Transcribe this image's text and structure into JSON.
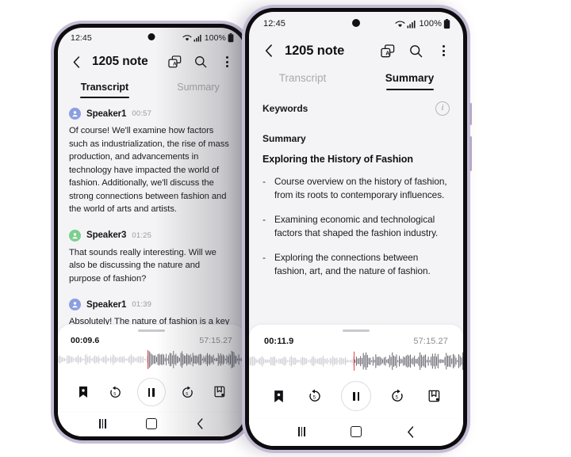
{
  "background_color": "#ffffff",
  "frame_color": "#c4bcd4",
  "bezel_color": "#0d0d10",
  "screen_bg": "#f4f4f6",
  "accent_playhead": "#e8413f",
  "phones": [
    {
      "id": "left",
      "status_bar": {
        "time": "12:45",
        "battery_percent": "100%"
      },
      "app_bar": {
        "title": "1205 note"
      },
      "tabs": [
        {
          "label": "Transcript",
          "active": true
        },
        {
          "label": "Summary",
          "active": false
        }
      ],
      "transcript": [
        {
          "speaker": "Speaker1",
          "time": "00:57",
          "avatar_color": "#8b9ee0",
          "text": "Of course! We'll examine how factors such as industrialization, the rise of mass production, and advancements in technology have impacted the world of fashion. Additionally, we'll discuss the strong connections between fashion and the world of arts and artists."
        },
        {
          "speaker": "Speaker3",
          "time": "01:25",
          "avatar_color": "#7ccf8e",
          "text": "That sounds really interesting. Will we also be discussing the nature and purpose of fashion?"
        },
        {
          "speaker": "Speaker1",
          "time": "01:39",
          "avatar_color": "#8b9ee0",
          "text": "Absolutely! The nature of fashion is a key topic we'll be exploring."
        }
      ],
      "player": {
        "current_time": "00:09.6",
        "total_time": "57:15.27",
        "playhead_percent": 48,
        "controls": [
          {
            "name": "bookmark-button",
            "label": "Bookmark"
          },
          {
            "name": "rewind-5-button",
            "label": "5"
          },
          {
            "name": "pause-button",
            "label": "Pause"
          },
          {
            "name": "forward-5-button",
            "label": "5"
          },
          {
            "name": "clip-note-button",
            "label": "Clip"
          }
        ]
      },
      "nav_bar": {
        "recents": "Recents",
        "home": "Home",
        "back": "Back"
      }
    },
    {
      "id": "right",
      "status_bar": {
        "time": "12:45",
        "battery_percent": "100%"
      },
      "app_bar": {
        "title": "1205 note"
      },
      "tabs": [
        {
          "label": "Transcript",
          "active": false
        },
        {
          "label": "Summary",
          "active": true
        }
      ],
      "summary": {
        "keywords_label": "Keywords",
        "summary_label": "Summary",
        "heading": "Exploring the History of Fashion",
        "bullets": [
          "Course overview on the history of fashion, from its roots to contemporary influences.",
          "Examining economic and technological factors that shaped the fashion industry.",
          "Exploring the connections between fashion, art, and the nature of fashion."
        ]
      },
      "player": {
        "current_time": "00:11.9",
        "total_time": "57:15.27",
        "playhead_percent": 49,
        "controls": [
          {
            "name": "bookmark-button",
            "label": "Bookmark"
          },
          {
            "name": "rewind-5-button",
            "label": "5"
          },
          {
            "name": "pause-button",
            "label": "Pause"
          },
          {
            "name": "forward-5-button",
            "label": "5"
          },
          {
            "name": "clip-note-button",
            "label": "Clip"
          }
        ]
      },
      "nav_bar": {
        "recents": "Recents",
        "home": "Home",
        "back": "Back"
      }
    }
  ]
}
